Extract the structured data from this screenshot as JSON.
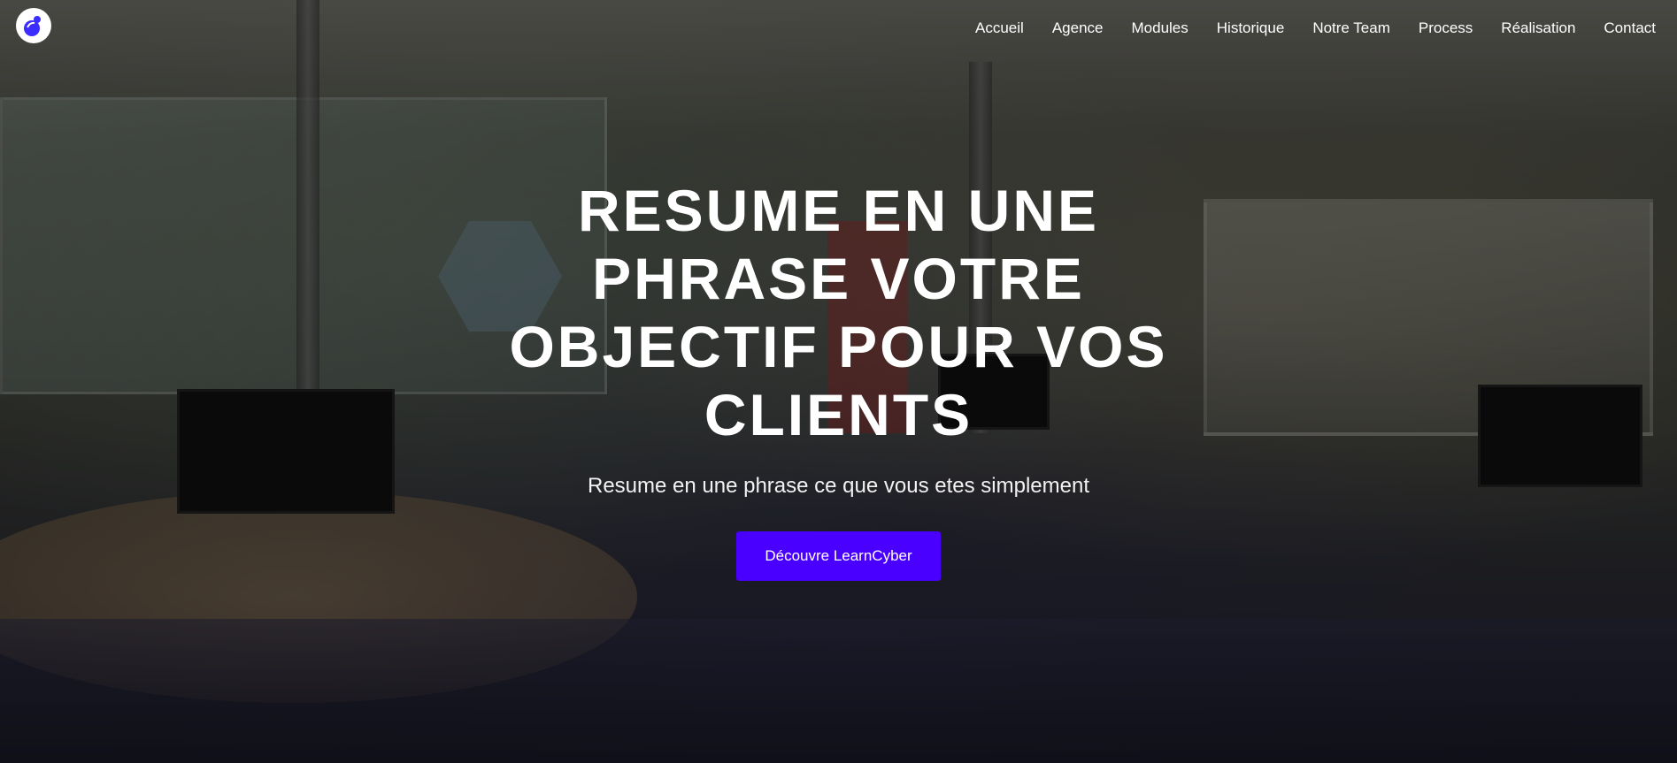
{
  "nav": {
    "logo_icon": "learncyber-logo-icon",
    "links": [
      "Accueil",
      "Agence",
      "Modules",
      "Historique",
      "Notre Team",
      "Process",
      "Réalisation",
      "Contact"
    ]
  },
  "hero": {
    "title": "RESUME EN UNE PHRASE VOTRE OBJECTIF POUR VOS CLIENTS",
    "subtitle": "Resume en une phrase ce que vous etes simplement",
    "cta_label": "Découvre LearnCyber",
    "background_image": "classroom-photo"
  },
  "colors": {
    "cta": "#4a00ff",
    "logo_accent": "#3b2cff",
    "text": "#ffffff"
  }
}
